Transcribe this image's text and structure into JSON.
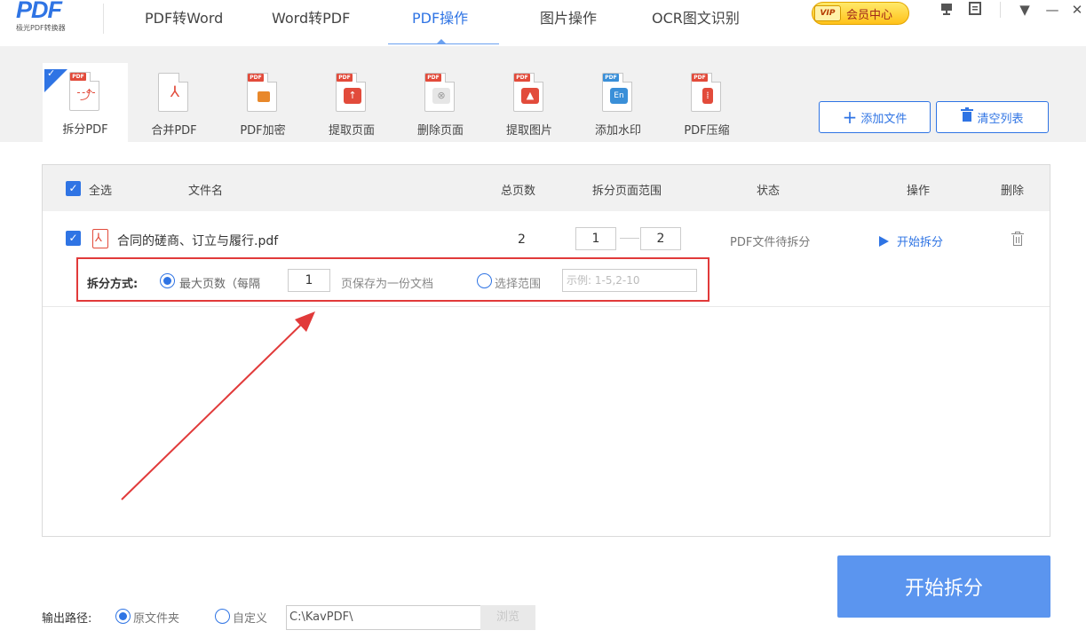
{
  "app": {
    "logo_text": "PDF",
    "logo_subtitle": "极光PDF转换器"
  },
  "nav": {
    "tabs": [
      {
        "label": "PDF转Word"
      },
      {
        "label": "Word转PDF"
      },
      {
        "label": "PDF操作",
        "active": true
      },
      {
        "label": "图片操作"
      },
      {
        "label": "OCR图文识别"
      }
    ],
    "vip_badge": "VIP",
    "vip_label": "会员中心"
  },
  "window_controls": {
    "icons": [
      "pin-icon",
      "feedback-icon",
      "menu-icon",
      "minimize-icon",
      "close-icon"
    ],
    "minimize": "—",
    "close": "✕",
    "menu": "▼"
  },
  "toolbar": {
    "tools": [
      {
        "label": "拆分PDF",
        "icon": "split-pdf-icon",
        "active": true
      },
      {
        "label": "合并PDF",
        "icon": "merge-pdf-icon"
      },
      {
        "label": "PDF加密",
        "icon": "encrypt-pdf-icon"
      },
      {
        "label": "提取页面",
        "icon": "extract-pages-icon"
      },
      {
        "label": "删除页面",
        "icon": "delete-pages-icon"
      },
      {
        "label": "提取图片",
        "icon": "extract-images-icon"
      },
      {
        "label": "添加水印",
        "icon": "watermark-icon"
      },
      {
        "label": "PDF压缩",
        "icon": "compress-pdf-icon"
      }
    ],
    "pdf_tag": "PDF",
    "add_file_label": "添加文件",
    "clear_list_label": "清空列表"
  },
  "table": {
    "headers": {
      "select_all": "全选",
      "filename": "文件名",
      "total_pages": "总页数",
      "range": "拆分页面范围",
      "status": "状态",
      "action": "操作",
      "delete": "删除"
    },
    "rows": [
      {
        "checked": true,
        "filename": "合同的磋商、订立与履行.pdf",
        "total_pages": "2",
        "range_from": "1",
        "range_to": "2",
        "status": "PDF文件待拆分",
        "action": "开始拆分"
      }
    ],
    "split_mode": {
      "label": "拆分方式:",
      "option_max_pages": "最大页数（每隔",
      "max_pages_value": "1",
      "max_pages_suffix": "页保存为一份文档",
      "option_range": "选择范围",
      "range_placeholder": "示例: 1-5,2-10"
    }
  },
  "footer": {
    "start_button": "开始拆分",
    "output_label": "输出路径:",
    "option_original": "原文件夹",
    "option_custom": "自定义",
    "path_value": "C:\\KavPDF\\",
    "browse": "浏览"
  },
  "colors": {
    "accent": "#2f74e4",
    "highlight_box": "#e13a3a",
    "start_button": "#5b95ef"
  }
}
